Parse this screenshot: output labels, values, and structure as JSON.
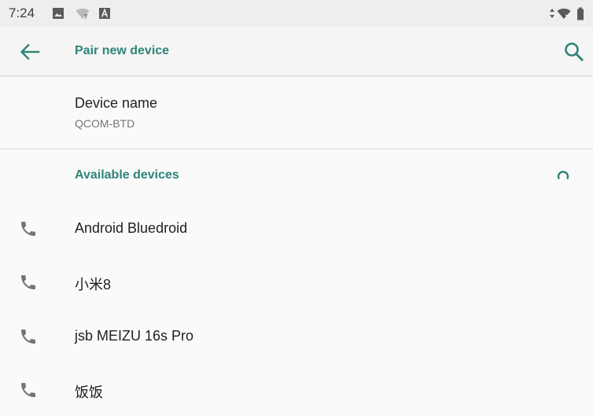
{
  "status_bar": {
    "time": "7:24",
    "left_icons": [
      "image-icon",
      "wifi-question-icon",
      "a-notification-icon"
    ],
    "right_icons": [
      "data-arrows-icon",
      "wifi-off-icon",
      "battery-icon"
    ]
  },
  "app_bar": {
    "back_icon": "arrow-back-icon",
    "title": "Pair new device",
    "search_icon": "search-icon"
  },
  "device_name": {
    "label": "Device name",
    "value": "QCOM-BTD"
  },
  "available": {
    "title": "Available devices",
    "progress_icon": "spinner-icon",
    "devices": [
      {
        "name": "Android Bluedroid",
        "icon": "phone-icon"
      },
      {
        "name": "小米8",
        "icon": "phone-icon"
      },
      {
        "name": "jsb MEIZU 16s Pro",
        "icon": "phone-icon"
      },
      {
        "name": "饭饭",
        "icon": "phone-icon"
      }
    ]
  },
  "colors": {
    "accent": "#2e8579",
    "icon_gray": "#757575",
    "background": "#fafafa",
    "status_bar": "#eeeeee"
  }
}
